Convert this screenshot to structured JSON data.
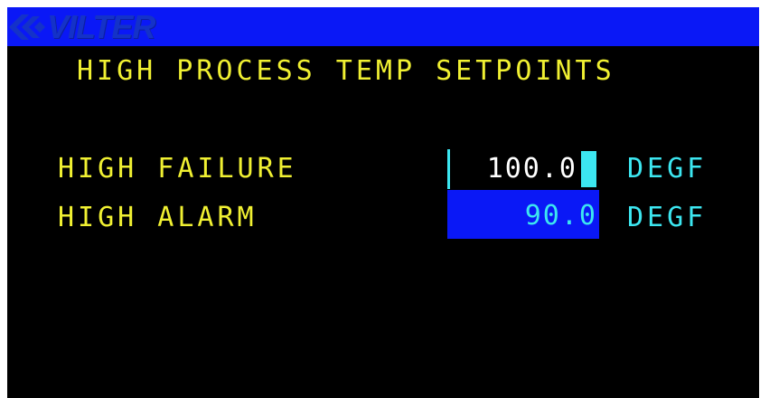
{
  "logo": {
    "text": "VILTER",
    "icon": "vilter-chevron-logo-icon"
  },
  "colors": {
    "top_bar": "#0a18f6",
    "background": "#000000",
    "label_text": "#f0f032",
    "unit_text": "#3ce6f0",
    "value_text": "#ffffff",
    "selected_bg": "#0a18f6"
  },
  "screen": {
    "title": "HIGH PROCESS TEMP SETPOINTS"
  },
  "setpoints": [
    {
      "label": "HIGH FAILURE",
      "value": "100.0",
      "unit": "DEGF",
      "state": "editing"
    },
    {
      "label": "HIGH ALARM",
      "value": "90.0",
      "unit": "DEGF",
      "state": "selected"
    }
  ]
}
